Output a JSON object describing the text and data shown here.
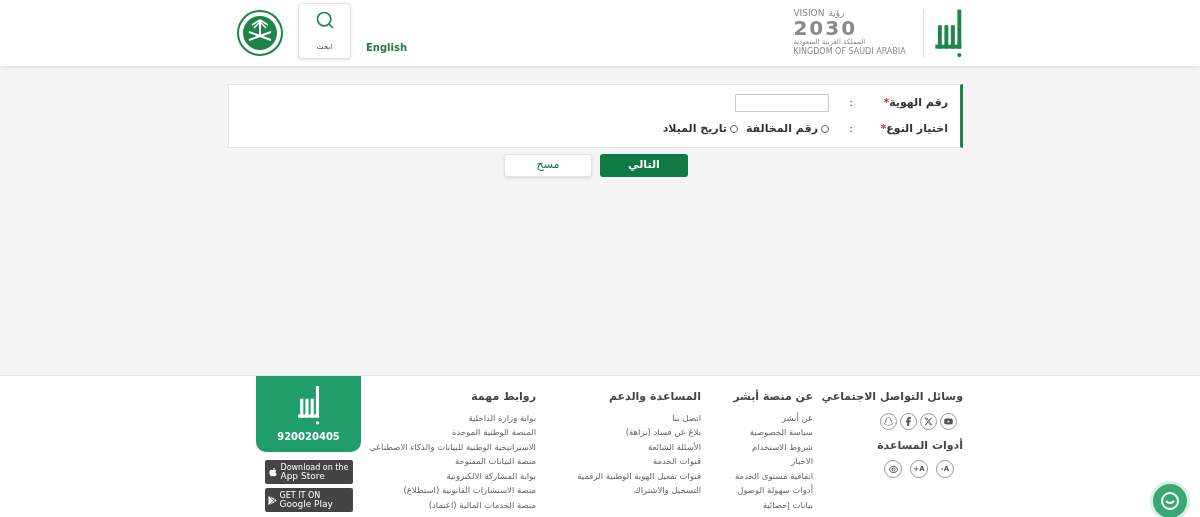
{
  "header": {
    "language_link": "English",
    "search": {
      "label": "ابحث"
    },
    "vision_logo": {
      "word": "VISION",
      "arabic_word": "رؤية",
      "year": "2030",
      "country_ar": "المملكة العربية السعودية",
      "country_en": "KINGDOM OF SAUDI ARABIA"
    }
  },
  "form": {
    "fields": [
      {
        "kind": "input",
        "label": "رقم الهوية",
        "required_mark": "*",
        "separator": ":"
      },
      {
        "kind": "radio",
        "label": "اختيار النوع",
        "required_mark": "*",
        "separator": ":",
        "options": [
          {
            "label": "رقم المخالفة",
            "selected": false
          },
          {
            "label": "تاريخ الميلاد",
            "selected": false
          }
        ]
      }
    ]
  },
  "buttons": [
    {
      "kind": "primary",
      "label": "التالي"
    },
    {
      "kind": "secondary",
      "label": "مسح"
    }
  ],
  "footer": {
    "social": {
      "title": "وسائل التواصل الاجتماعي",
      "icons": [
        {
          "kind": "youtube"
        },
        {
          "kind": "x"
        },
        {
          "kind": "facebook"
        },
        {
          "kind": "snapchat"
        }
      ]
    },
    "tools": {
      "title": "أدوات المساعدة",
      "items": [
        {
          "kind": "text",
          "label": "-A"
        },
        {
          "kind": "text",
          "label": "+A"
        },
        {
          "kind": "eye"
        }
      ]
    },
    "columns": [
      {
        "title": "عن منصة أبشر",
        "links": [
          "عن أبشر",
          "سياسة الخصوصية",
          "شروط الاستخدام",
          "الاخبار",
          "اتفاقية مستوى الخدمة",
          "أدوات سهولة الوصول",
          "بيانات إحصائية"
        ]
      },
      {
        "title": "المساعدة والدعم",
        "links": [
          "اتصل بنا",
          "بلاغ عن فساد (نزاهة)",
          "الأسئلة الشائعة",
          "قنوات الخدمة",
          "قنوات تفعيل الهوية الوطنية الرقمية",
          "التسجيل والاشتراك"
        ]
      },
      {
        "title": "روابط مهمة",
        "links": [
          "بوابة وزارة الداخلية",
          "المنصة الوطنية الموحدة",
          "الاستراتيجية الوطنية للبيانات والذكاء الاصطناعي",
          "منصة البيانات المفتوحة",
          "بوابة المشاركة الالكترونية",
          "منصة الاستشارات القانونية (استطلاع)",
          "منصة الخدمات المالية (اعتماد)"
        ]
      }
    ],
    "contact": {
      "phone": "920020405"
    },
    "stores": [
      {
        "kind": "apple",
        "small": "Download on the",
        "big": "App Store"
      },
      {
        "kind": "google",
        "small": "GET IT ON",
        "big": "Google Play"
      }
    ]
  }
}
